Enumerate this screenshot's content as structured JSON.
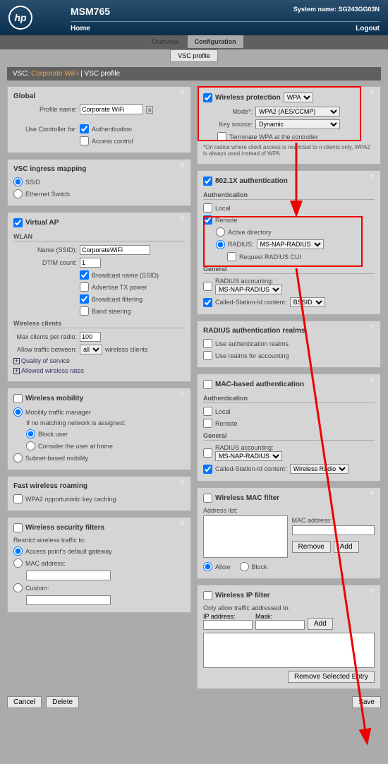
{
  "header": {
    "logo_text": "hp",
    "product": "MSM765",
    "system_name_label": "System name:",
    "system_name": "SG243GG03N",
    "nav_home": "Home",
    "nav_logout": "Logout"
  },
  "tabs": {
    "overview": "Overview",
    "configuration": "Configuration",
    "sub_vsc": "VSC profile"
  },
  "page_header": {
    "prefix": "VSC:",
    "name": "Corporate WiFi",
    "sep": "|",
    "suffix": "VSC profile"
  },
  "global": {
    "title": "Global",
    "profile_name_lbl": "Profile name:",
    "profile_name": "Corporate WiFi",
    "use_controller_lbl": "Use Controller for:",
    "auth_lbl": "Authentication",
    "access_lbl": "Access control"
  },
  "ingress": {
    "title": "VSC ingress mapping",
    "ssid": "SSID",
    "eth": "Ethernet Switch"
  },
  "vap": {
    "title": "Virtual AP",
    "wlan": "WLAN",
    "name_lbl": "Name (SSID):",
    "name": "CorporateWiFi",
    "dtim_lbl": "DTIM count:",
    "dtim": "1",
    "bcast_ssid": "Broadcast name (SSID)",
    "adv_tx": "Advertise TX power",
    "bcast_filt": "Broadcast filtering",
    "band_steer": "Band steering",
    "wclients": "Wireless clients",
    "maxc_lbl": "Max clients per radio:",
    "maxc": "100",
    "allow_lbl": "Allow traffic between:",
    "allow_sel": "all",
    "allow_suffix": "wireless clients",
    "qos": "Quality of service",
    "rates": "Allowed wireless rates"
  },
  "mobility": {
    "title": "Wireless mobility",
    "mtm": "Mobility traffic manager",
    "if_no": "If no matching network is assigned:",
    "block": "Block user",
    "home": "Consider the user at home",
    "subnet": "Subnet-based mobility"
  },
  "roaming": {
    "title": "Fast wireless roaming",
    "wpa2_ok": "WPA2 opportunistic key caching"
  },
  "secfilt": {
    "title": "Wireless security filters",
    "restrict": "Restrict wireless traffic to:",
    "ap_gw": "Access point's default gateway",
    "mac": "MAC address:",
    "custom": "Custom:"
  },
  "wprot": {
    "title": "Wireless protection",
    "sel": "WPA",
    "mode_lbl": "Mode*:",
    "mode": "WPA2 (AES/CCMP)",
    "key_lbl": "Key source:",
    "key": "Dynamic",
    "term": "Terminate WPA at the controller",
    "note": "*On radios where client access is restricted to n-clients only, WPA2 is always used instead of WPA"
  },
  "dot1x": {
    "title": "802.1X authentication",
    "auth": "Authentication",
    "local": "Local",
    "remote": "Remote",
    "ad": "Active directory",
    "radius_lbl": "RADIUS:",
    "radius": "MS-NAP-RADIUS",
    "req_cui": "Request RADIUS CUI",
    "general": "General",
    "ra_lbl": "RADIUS accounting:",
    "ra": "MS-NAP-RADIUS",
    "csi_lbl": "Called-Station-Id content:",
    "csi": "BSSID"
  },
  "realms": {
    "title": "RADIUS authentication realms",
    "use": "Use authentication realms",
    "acct": "Use realms for accounting"
  },
  "macauth": {
    "title": "MAC-based authentication",
    "auth": "Authentication",
    "local": "Local",
    "remote": "Remote",
    "general": "General",
    "ra_lbl": "RADIUS accounting:",
    "ra": "MS-NAP-RADIUS",
    "csi_lbl": "Called-Station-Id content:",
    "csi": "Wireless Radio"
  },
  "macfilt": {
    "title": "Wireless MAC filter",
    "addr_list": "Address list:",
    "mac_lbl": "MAC address:",
    "remove": "Remove",
    "add": "Add",
    "allow": "Allow",
    "block": "Block"
  },
  "ipfilt": {
    "title": "Wireless IP filter",
    "only": "Only allow traffic addressed to:",
    "ip_lbl": "IP address:",
    "mask_lbl": "Mask:",
    "add": "Add",
    "remove": "Remove Selected Entry"
  },
  "footer": {
    "cancel": "Cancel",
    "delete": "Delete",
    "save": "Save"
  }
}
